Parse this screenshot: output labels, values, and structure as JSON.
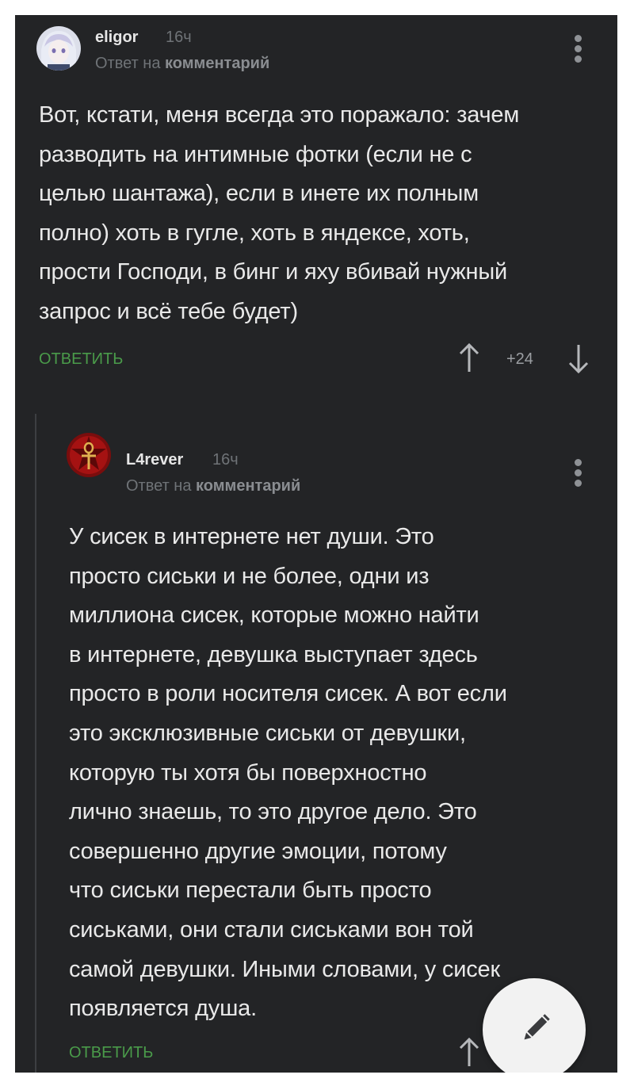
{
  "comments": [
    {
      "author": "eligor",
      "time": "16ч",
      "reply_prefix": "Ответ на",
      "reply_target": "комментарий",
      "text": "Вот, кстати, меня всегда это поражало: зачем\nразводить на интимные фотки (если не с\nцелью шантажа), если в инете их полным\nполно) хоть в гугле, хоть в яндексе, хоть,\nпрости Господи, в бинг и яху вбивай нужный\nзапрос и всё тебе будет)",
      "reply_label": "ОТВЕТИТЬ",
      "score": "+24",
      "avatar_icon": "anime-avatar-icon"
    },
    {
      "author": "L4rever",
      "time": "16ч",
      "reply_prefix": "Ответ на",
      "reply_target": "комментарий",
      "text": "У сисек в интернете нет души. Это\nпросто сиськи и не более, одни из\nмиллиона сисек, которые можно найти\nв интернете, девушка выступает здесь\nпросто в роли носителя сисек. А вот если\nэто эксклюзивные сиськи от девушки,\nкоторую ты хотя бы поверхностно\nлично знаешь, то это другое дело. Это\nсовершенно другие эмоции, потому\nчто сиськи перестали быть просто\nсиськами, они стали сиськами вон той\nсамой девушки. Иными словами, у сисек\nпоявляется душа.",
      "reply_label": "ОТВЕТИТЬ",
      "avatar_icon": "ankh-avatar-icon"
    }
  ],
  "colors": {
    "background": "#232426",
    "text": "#e9e9e9",
    "accent_green": "#4a9b4a",
    "muted": "#6f7377"
  },
  "fab_icon": "pencil-icon"
}
